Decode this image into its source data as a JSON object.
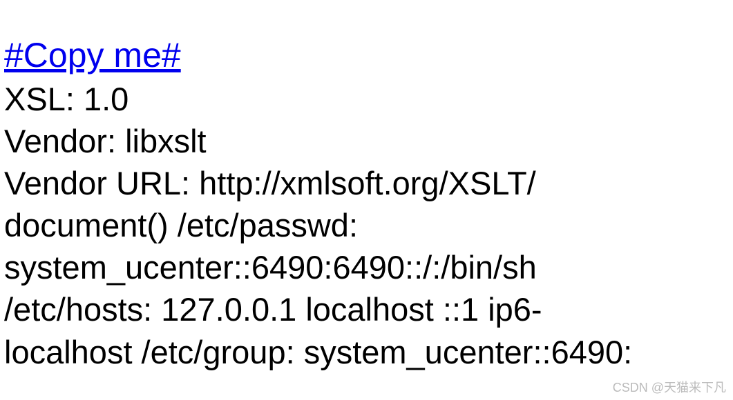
{
  "link": {
    "text": "#Copy me#"
  },
  "lines": {
    "xsl": "XSL: 1.0",
    "vendor": "Vendor: libxslt",
    "vendorUrl": "Vendor URL: http://xmlsoft.org/XSLT/",
    "docPasswd": "document() /etc/passwd:",
    "systemUcenter": "system_ucenter::6490:6490::/:/bin/sh",
    "etcHosts": "/etc/hosts: 127.0.0.1 localhost ::1 ip6-",
    "localhostGroup": "localhost /etc/group: system_ucenter::6490:"
  },
  "watermark": "CSDN @天猫来下凡"
}
